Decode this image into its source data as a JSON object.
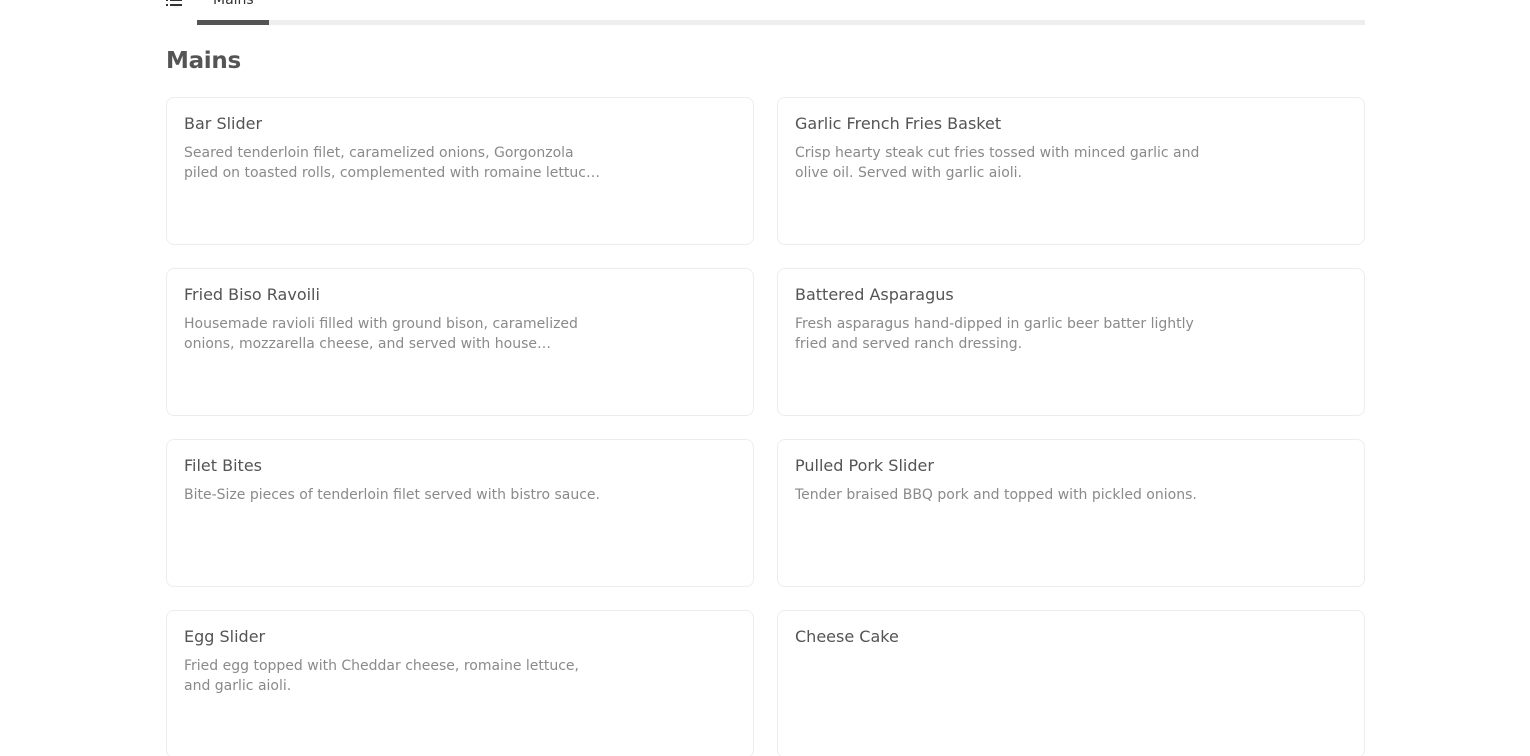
{
  "tabs": {
    "active_label": "Mains"
  },
  "section": {
    "title": "Mains"
  },
  "items": [
    {
      "name": "Bar Slider",
      "description": "Seared tenderloin filet, caramelized onions, Gorgonzola piled on toasted rolls, complemented with romaine lettuce, and..."
    },
    {
      "name": "Garlic French Fries Basket",
      "description": "Crisp hearty steak cut fries tossed with minced garlic and olive oil. Served with garlic aioli."
    },
    {
      "name": "Fried Biso Ravoili",
      "description": "Housemade ravioli filled with ground bison, caramelized onions, mozzarella cheese, and served with house marinara."
    },
    {
      "name": "Battered Asparagus",
      "description": "Fresh asparagus hand-dipped in garlic beer batter lightly fried and served ranch dressing."
    },
    {
      "name": "Filet Bites",
      "description": "Bite-Size pieces of tenderloin filet served with bistro sauce."
    },
    {
      "name": "Pulled Pork Slider",
      "description": "Tender braised BBQ pork and topped with pickled onions."
    },
    {
      "name": "Egg Slider",
      "description": "Fried egg topped with Cheddar cheese, romaine lettuce, and garlic aioli."
    },
    {
      "name": "Cheese Cake",
      "description": ""
    }
  ]
}
